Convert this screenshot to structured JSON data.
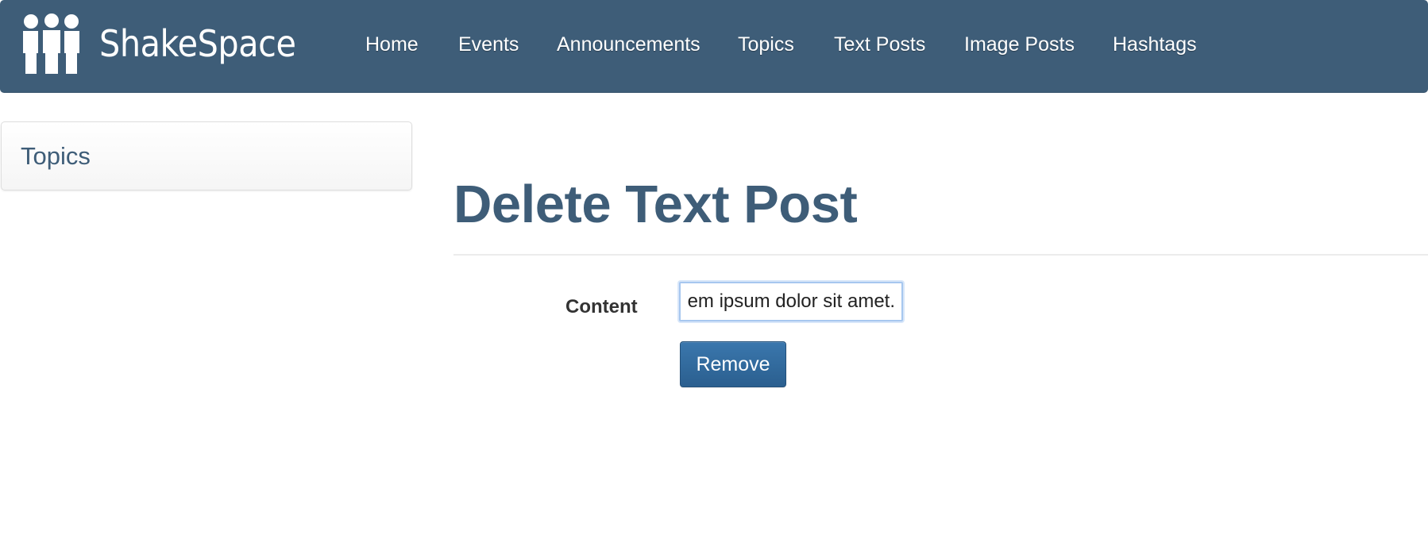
{
  "app": {
    "brand_name": "ShakeSpace",
    "brand_icon": "people-group-icon"
  },
  "nav": {
    "items": [
      {
        "label": "Home"
      },
      {
        "label": "Events"
      },
      {
        "label": "Announcements"
      },
      {
        "label": "Topics"
      },
      {
        "label": "Text Posts"
      },
      {
        "label": "Image Posts"
      },
      {
        "label": "Hashtags"
      }
    ]
  },
  "sidebar": {
    "title": "Topics"
  },
  "main": {
    "title": "Delete Text Post",
    "form": {
      "content_label": "Content",
      "content_value": "em ipsum dolor sit amet.",
      "submit_label": "Remove"
    }
  },
  "colors": {
    "navbar": "#3e5d78",
    "heading": "#3e5d78",
    "button": "#2f6699",
    "input_focus": "#a7c7ef"
  }
}
